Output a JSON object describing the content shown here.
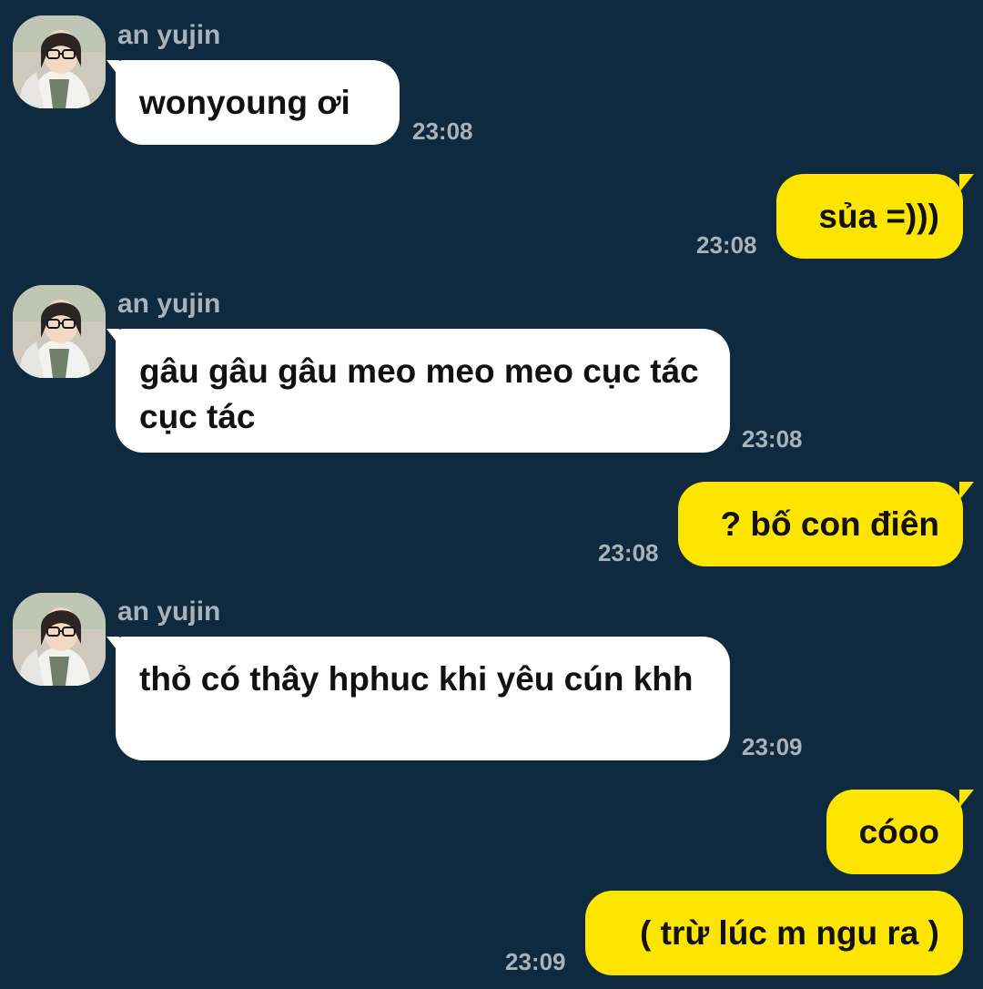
{
  "chat": {
    "messages": [
      {
        "direction": "incoming",
        "sender": "an yujin",
        "text": "wonyoung ơi",
        "time": "23:08"
      },
      {
        "direction": "outgoing",
        "text": "sủa =)))",
        "time": "23:08"
      },
      {
        "direction": "incoming",
        "sender": "an yujin",
        "text": "gâu gâu gâu meo meo meo cục tác cục tác",
        "time": "23:08"
      },
      {
        "direction": "outgoing",
        "text": "? bố con điên",
        "time": "23:08"
      },
      {
        "direction": "incoming",
        "sender": "an yujin",
        "text": "thỏ có thây hphuc khi yêu cún khh",
        "time": "23:09"
      },
      {
        "direction": "outgoing",
        "text": "cóoo",
        "time": ""
      },
      {
        "direction": "outgoing",
        "text": "( trừ lúc m ngu ra )",
        "time": "23:09"
      }
    ]
  },
  "colors": {
    "background": "#0f2a3f",
    "incoming_bubble": "#ffffff",
    "outgoing_bubble": "#fee500",
    "meta_text": "#a8b2ba",
    "message_text": "#111111"
  },
  "icons": {
    "avatar": "profile-photo-avatar-icon"
  }
}
